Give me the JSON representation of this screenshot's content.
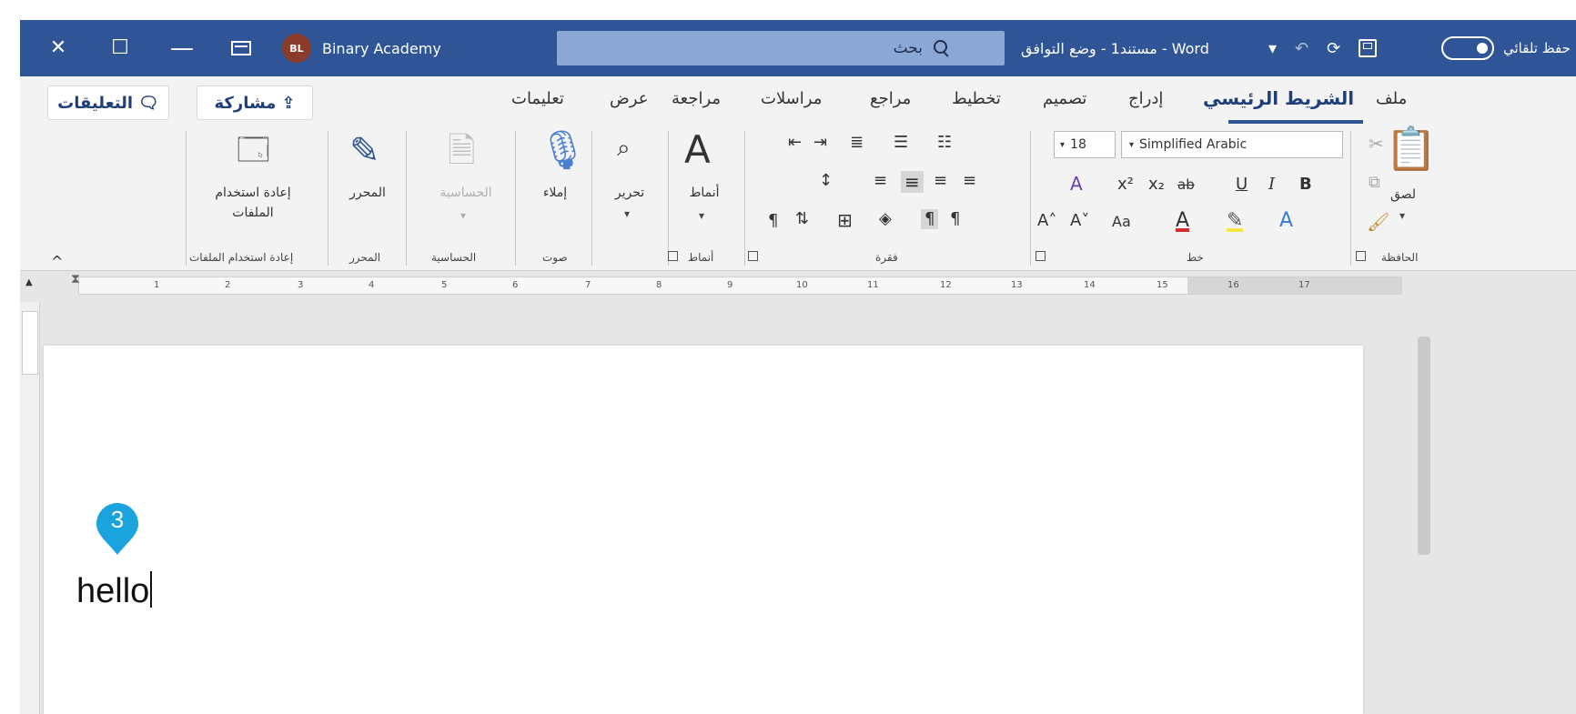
{
  "titlebar": {
    "account_name": "Binary Academy",
    "account_initials": "BL",
    "search_placeholder": "بحث",
    "document_title": "Word - مستند1 - وضع التوافق",
    "autosave_label": "حفظ تلقائي",
    "close_glyph": "✕",
    "restore_glyph": "☐",
    "minimize_glyph": "—",
    "undo_glyph": "↶",
    "redo_glyph": "⟳",
    "customize_glyph": "▾"
  },
  "tabs": {
    "file": "ملف",
    "home": "الشريط الرئيسي",
    "insert": "إدراج",
    "design": "تصميم",
    "layout": "تخطيط",
    "references": "مراجع",
    "mailings": "مراسلات",
    "review": "مراجعة",
    "view": "عرض",
    "help": "تعليمات",
    "share": "مشاركة",
    "comments": "التعليقات"
  },
  "ribbon": {
    "clipboard": {
      "group": "الحافظة",
      "paste": "لصق"
    },
    "font": {
      "group": "خط",
      "font_name": "Simplified Arabic",
      "font_size": "18",
      "bold": "B",
      "italic": "I",
      "underline": "U",
      "strikethrough": "ab",
      "subscript": "x₂",
      "superscript": "x²",
      "grow": "A˄",
      "shrink": "A˅",
      "case": "Aa",
      "highlight_color": "#f5e642",
      "font_color": "#d32f2f"
    },
    "paragraph": {
      "group": "فقرة"
    },
    "styles": {
      "group": "أنماط",
      "label": "أنماط"
    },
    "editing": {
      "label": "تحرير"
    },
    "voice": {
      "group": "صوت",
      "dictate": "إملاء"
    },
    "sensitivity": {
      "group": "الحساسية",
      "label": "الحساسية"
    },
    "editor": {
      "group": "المحرر",
      "label": "المحرر"
    },
    "reuse": {
      "group": "إعادة استخدام الملفات",
      "label_line1": "إعادة استخدام",
      "label_line2": "الملفات"
    }
  },
  "ruler": {
    "ticks": [
      "1",
      "2",
      "3",
      "4",
      "5",
      "6",
      "7",
      "8",
      "9",
      "10",
      "11",
      "12",
      "13",
      "14",
      "15",
      "16",
      "17"
    ]
  },
  "document": {
    "text": "hello",
    "marker_number": "3",
    "marker_color": "#1aa3dd"
  },
  "colors": {
    "titlebar": "#2f5597",
    "accent": "#1f3f7a"
  }
}
